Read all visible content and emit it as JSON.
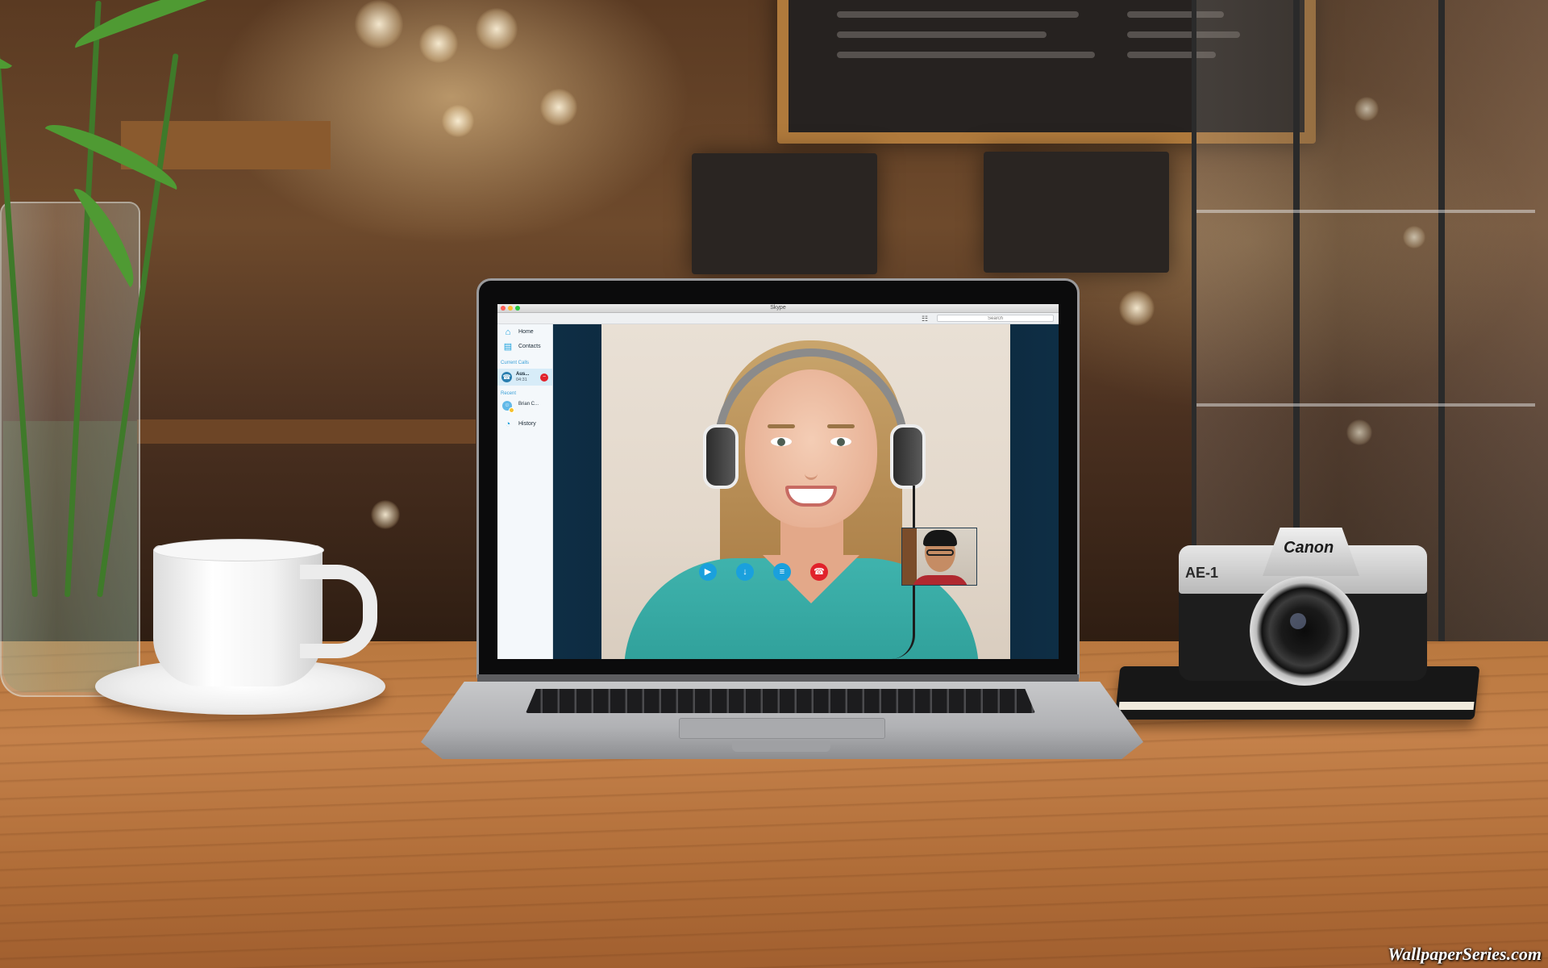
{
  "window": {
    "title": "Skype"
  },
  "toolbar": {
    "dialpad_icon": "dialpad-icon",
    "search_placeholder": "Search"
  },
  "sidebar": {
    "items": [
      {
        "label": "Home",
        "icon": "home-icon"
      },
      {
        "label": "Contacts",
        "icon": "contacts-icon"
      }
    ],
    "current_calls_label": "Current Calls",
    "current_call": {
      "name": "Aus...",
      "duration": "04:31",
      "icon": "phone-icon"
    },
    "recent_label": "Recent",
    "recent": [
      {
        "label": "Brian C...",
        "icon": "avatar-icon",
        "status": "away"
      }
    ],
    "history": {
      "label": "History",
      "icon": "clock-icon"
    }
  },
  "call": {
    "controls": [
      {
        "name": "video-toggle",
        "icon": "video-camera-icon",
        "color": "#1aa0dd"
      },
      {
        "name": "mic-toggle",
        "icon": "microphone-icon",
        "color": "#1aa0dd"
      },
      {
        "name": "more-options",
        "icon": "menu-icon",
        "color": "#1aa0dd"
      },
      {
        "name": "end-call",
        "icon": "hang-up-icon",
        "color": "#e1222b"
      }
    ]
  },
  "scene": {
    "camera_brand": "Canon",
    "camera_model": "AE-1",
    "watermark": "WallpaperSeries.com"
  },
  "colors": {
    "skype_blue": "#1aa0dd",
    "end_call_red": "#e1222b",
    "call_stage_bg": "#0a2133"
  }
}
